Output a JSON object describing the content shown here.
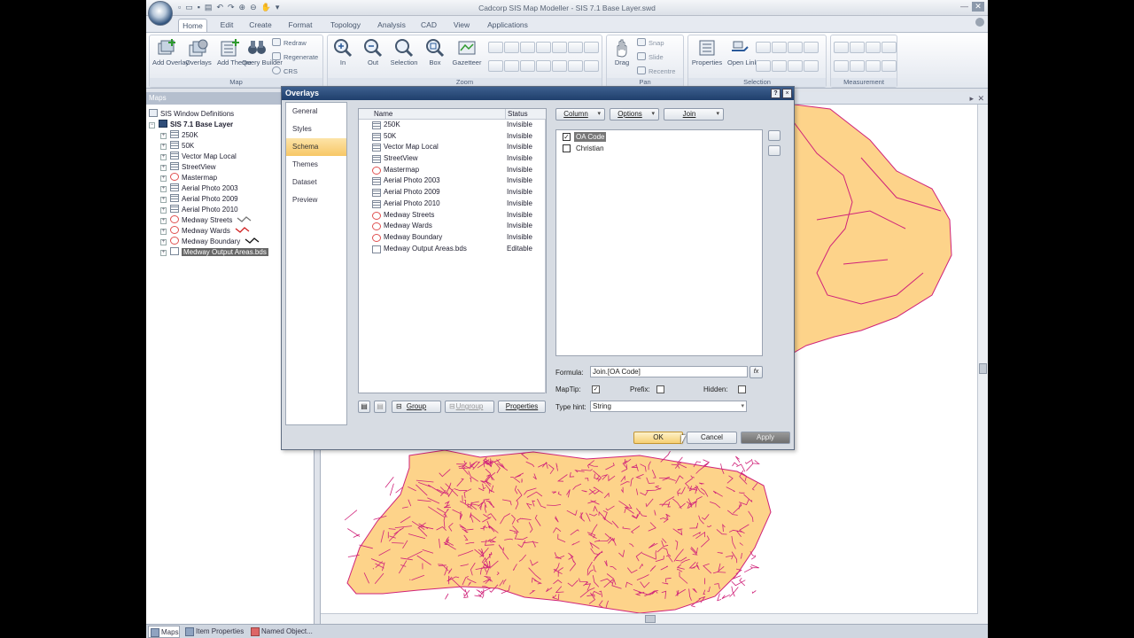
{
  "window": {
    "title": "Cadcorp SIS Map Modeller - SIS 7.1 Base Layer.swd"
  },
  "ribbon": {
    "tabs": [
      "Home",
      "Edit",
      "Create",
      "Format",
      "Topology",
      "Analysis",
      "CAD",
      "View",
      "Applications"
    ],
    "active_tab": "Home",
    "groups": {
      "map": "Map",
      "zoom": "Zoom",
      "pan": "Pan",
      "selection": "Selection",
      "measurement": "Measurement"
    },
    "map_buttons": {
      "add_overlay": "Add Overlay",
      "overlays": "Overlays",
      "add_theme": "Add Theme",
      "query_builder": "Query Builder",
      "redraw": "Redraw",
      "regenerate": "Regenerate",
      "crs": "CRS"
    },
    "zoom_buttons": {
      "in": "In",
      "out": "Out",
      "selection": "Selection",
      "box": "Box",
      "gazetteer": "Gazetteer"
    },
    "pan_buttons": {
      "drag": "Drag",
      "snap": "Snap",
      "slide": "Slide",
      "recentre": "Recentre"
    },
    "selection_buttons": {
      "properties": "Properties",
      "open_link": "Open Link"
    }
  },
  "maps_panel": {
    "title": "Maps",
    "tree": [
      {
        "label": "SIS Window Definitions",
        "level": 0,
        "icon": "windows-icon"
      },
      {
        "label": "SIS 7.1 Base Layer",
        "level": 0,
        "icon": "map-icon",
        "bold": true
      },
      {
        "label": "250K",
        "level": 1,
        "icon": "grid-icon"
      },
      {
        "label": "50K",
        "level": 1,
        "icon": "grid-icon"
      },
      {
        "label": "Vector Map Local",
        "level": 1,
        "icon": "grid-icon"
      },
      {
        "label": "StreetView",
        "level": 1,
        "icon": "grid-icon"
      },
      {
        "label": "Mastermap",
        "level": 1,
        "icon": "red-circle-icon"
      },
      {
        "label": "Aerial Photo 2003",
        "level": 1,
        "icon": "grid-icon"
      },
      {
        "label": "Aerial Photo 2009",
        "level": 1,
        "icon": "grid-icon"
      },
      {
        "label": "Aerial Photo 2010",
        "level": 1,
        "icon": "grid-icon"
      },
      {
        "label": "Medway Streets",
        "level": 1,
        "icon": "red-circle-icon"
      },
      {
        "label": "Medway Wards",
        "level": 1,
        "icon": "red-circle-icon"
      },
      {
        "label": "Medway Boundary",
        "level": 1,
        "icon": "red-circle-icon"
      },
      {
        "label": "Medway Output Areas.bds",
        "level": 1,
        "icon": "file-icon",
        "selected": true
      }
    ]
  },
  "bottom_tabs": [
    "Maps",
    "Item Properties",
    "Named Object..."
  ],
  "dialog": {
    "title": "Overlays",
    "help": "?",
    "close": "×",
    "nav": [
      "General",
      "Styles",
      "Schema",
      "Themes",
      "Dataset",
      "Preview"
    ],
    "active_nav": "Schema",
    "list_headers": {
      "name": "Name",
      "status": "Status"
    },
    "overlays": [
      {
        "name": "250K",
        "status": "Invisible",
        "icon": "grid-icon"
      },
      {
        "name": "50K",
        "status": "Invisible",
        "icon": "grid-icon"
      },
      {
        "name": "Vector Map Local",
        "status": "Invisible",
        "icon": "grid-icon"
      },
      {
        "name": "StreetView",
        "status": "Invisible",
        "icon": "grid-icon"
      },
      {
        "name": "Mastermap",
        "status": "Invisible",
        "icon": "red-circle-icon"
      },
      {
        "name": "Aerial Photo 2003",
        "status": "Invisible",
        "icon": "grid-icon"
      },
      {
        "name": "Aerial Photo 2009",
        "status": "Invisible",
        "icon": "grid-icon"
      },
      {
        "name": "Aerial Photo 2010",
        "status": "Invisible",
        "icon": "grid-icon"
      },
      {
        "name": "Medway Streets",
        "status": "Invisible",
        "icon": "red-circle-icon"
      },
      {
        "name": "Medway Wards",
        "status": "Invisible",
        "icon": "red-circle-icon"
      },
      {
        "name": "Medway Boundary",
        "status": "Invisible",
        "icon": "red-circle-icon"
      },
      {
        "name": "Medway Output Areas.bds",
        "status": "Editable",
        "icon": "file-icon"
      }
    ],
    "list_buttons": {
      "group": "Group",
      "ungroup": "Ungroup",
      "properties": "Properties"
    },
    "schema_buttons": {
      "column": "Column",
      "options": "Options",
      "join": "Join"
    },
    "schema_columns": [
      {
        "label": "OA Code",
        "checked": true,
        "selected": true
      },
      {
        "label": "Christian",
        "checked": false,
        "selected": false
      }
    ],
    "formula_label": "Formula:",
    "formula_value": "Join.[OA Code]",
    "formula_button": "fx",
    "maptip_label": "MapTip:",
    "maptip_checked": true,
    "prefix_label": "Prefix:",
    "prefix_checked": false,
    "hidden_label": "Hidden:",
    "hidden_checked": false,
    "type_hint_label": "Type hint:",
    "type_hint_value": "String",
    "ok": "OK",
    "cancel": "Cancel",
    "apply": "Apply"
  },
  "colors": {
    "map_fill": "#fdd38a",
    "map_stroke": "#d0237a",
    "dialog_title": "#1f3f6c",
    "selected_nav": "#f7c766"
  }
}
